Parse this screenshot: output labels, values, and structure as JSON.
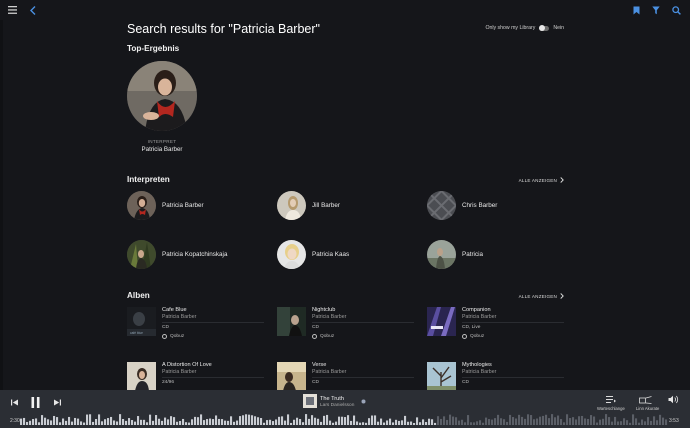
{
  "header": {
    "title": "Search results for \"Patricia Barber\""
  },
  "library_filter": {
    "label": "Only show my Library",
    "value": "Nein"
  },
  "top_result": {
    "section": "Top-Ergebnis",
    "type": "INTERPRET",
    "name": "Patricia Barber"
  },
  "artists": {
    "section": "Interpreten",
    "show_all": "ALLE ANZEIGEN",
    "items": [
      {
        "name": "Patricia Barber"
      },
      {
        "name": "Jill Barber"
      },
      {
        "name": "Chris Barber"
      },
      {
        "name": "Patricia Kopatchinskaja"
      },
      {
        "name": "Patricia Kaas"
      },
      {
        "name": "Patricia"
      }
    ]
  },
  "albums": {
    "section": "Alben",
    "show_all": "ALLE ANZEIGEN",
    "items": [
      {
        "title": "Cafe Blue",
        "artist": "Patricia Barber",
        "format": "CD",
        "source": "Qobuz"
      },
      {
        "title": "Nightclub",
        "artist": "Patricia Barber",
        "format": "CD",
        "source": "Qobuz"
      },
      {
        "title": "Companion",
        "artist": "Patricia Barber",
        "format": "CD, Live",
        "source": "Qobuz"
      },
      {
        "title": "A Distortion Of Love",
        "artist": "Patricia Barber",
        "format": "24/96"
      },
      {
        "title": "Verse",
        "artist": "Patricia Barber",
        "format": "CD"
      },
      {
        "title": "Mythologies",
        "artist": "Patricia Barber",
        "format": "CD"
      }
    ]
  },
  "player": {
    "track_title": "The Truth",
    "track_artist": "Lars Danielsson",
    "elapsed": "2:30",
    "duration": "3:53",
    "progress": 0.64,
    "queue_label": "Warteschlange",
    "zone_label": "Linn Akurate"
  },
  "colors": {
    "accent": "#4a90e2",
    "background": "#15161a",
    "player_bg": "#2b2e34"
  }
}
